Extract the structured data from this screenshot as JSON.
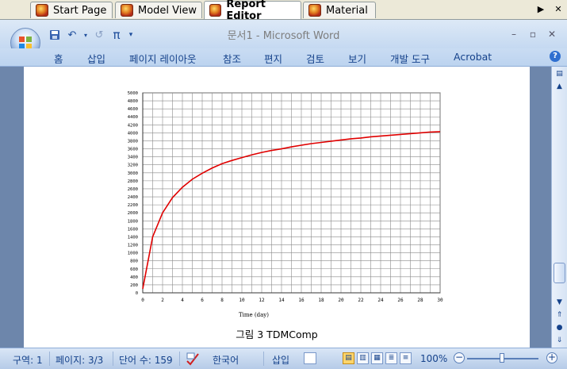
{
  "tabs": [
    {
      "label": "Start Page",
      "active": false
    },
    {
      "label": "Model View",
      "active": false
    },
    {
      "label": "Report Editor",
      "active": true
    },
    {
      "label": "Material",
      "active": false
    }
  ],
  "window": {
    "title": "문서1 - Microsoft Word"
  },
  "qat": {
    "undo_label": "↶",
    "redo_label": "↺",
    "pi_label": "π"
  },
  "ribbon": {
    "tabs": [
      "홈",
      "삽입",
      "페이지 레이아웃",
      "참조",
      "편지",
      "검토",
      "보기",
      "개발 도구",
      "Acrobat"
    ],
    "help_label": "?"
  },
  "document": {
    "caption": "그림 3 TDMComp"
  },
  "chart_data": {
    "type": "line",
    "xlabel": "Time (day)",
    "ylabel": "",
    "xlim": [
      0,
      30
    ],
    "ylim": [
      0,
      5000
    ],
    "xticks": [
      0,
      2,
      4,
      6,
      8,
      10,
      12,
      14,
      16,
      18,
      20,
      22,
      24,
      26,
      28,
      30
    ],
    "yticks": [
      0,
      200,
      400,
      600,
      800,
      1000,
      1200,
      1400,
      1600,
      1800,
      2000,
      2200,
      2400,
      2600,
      2800,
      3000,
      3200,
      3400,
      3600,
      3800,
      4000,
      4200,
      4400,
      4600,
      4800,
      5000
    ],
    "grid": true,
    "series": [
      {
        "color": "#e00000",
        "x": [
          0,
          1,
          2,
          3,
          4,
          5,
          6,
          7,
          8,
          9,
          10,
          11,
          12,
          13,
          14,
          15,
          16,
          17,
          18,
          19,
          20,
          21,
          22,
          23,
          24,
          25,
          26,
          27,
          28,
          29,
          30
        ],
        "y": [
          100,
          1400,
          2000,
          2380,
          2640,
          2840,
          2990,
          3120,
          3230,
          3310,
          3380,
          3450,
          3510,
          3560,
          3600,
          3650,
          3690,
          3730,
          3760,
          3790,
          3820,
          3850,
          3870,
          3900,
          3920,
          3940,
          3960,
          3980,
          4000,
          4020,
          4030
        ]
      }
    ]
  },
  "status": {
    "section": "구역: 1",
    "page": "페이지: 3/3",
    "words": "단어 수: 159",
    "language": "한국어",
    "insert_mode": "삽입",
    "zoom": "100%",
    "zoom_minus": "−",
    "zoom_plus": "+"
  },
  "scroll": {
    "up": "▲",
    "down": "▼",
    "prev": "⇑",
    "select": "●",
    "next": "⇓",
    "ruler": "▤"
  }
}
